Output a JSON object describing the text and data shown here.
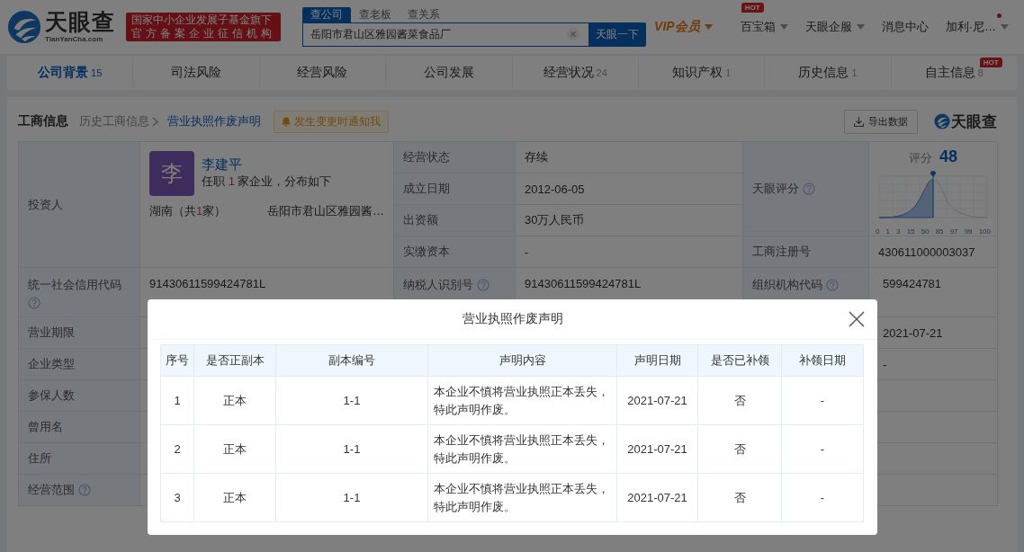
{
  "header": {
    "logo": {
      "name": "天眼查",
      "domain": "TianYanCha.com"
    },
    "slogan": [
      "国家中小企业发展子基金旗下",
      "官方备案企业征信机构"
    ],
    "search_tabs": [
      {
        "label": "查公司",
        "selected": true
      },
      {
        "label": "查老板",
        "selected": false
      },
      {
        "label": "查关系",
        "selected": false
      }
    ],
    "search": {
      "value": "岳阳市君山区雅园酱菜食品厂",
      "button": "天眼一下"
    },
    "nav": [
      {
        "kind": "vip",
        "label": "VIP会员"
      },
      {
        "kind": "menu",
        "label": "百宝箱",
        "badge": "HOT"
      },
      {
        "kind": "menu",
        "label": "天眼企服"
      },
      {
        "kind": "link",
        "label": "消息中心"
      },
      {
        "kind": "user",
        "label": "加利·尼…",
        "unread": true
      }
    ]
  },
  "tabs": [
    {
      "label": "公司背景",
      "count": "15",
      "selected": true
    },
    {
      "label": "司法风险",
      "selected": false
    },
    {
      "label": "经营风险",
      "selected": false
    },
    {
      "label": "公司发展",
      "selected": false
    },
    {
      "label": "经营状况",
      "count": "24",
      "selected": false
    },
    {
      "label": "知识产权",
      "count": "1",
      "selected": false
    },
    {
      "label": "历史信息",
      "count": "1",
      "selected": false
    },
    {
      "label": "自主信息",
      "count": "8",
      "badge": "HOT",
      "selected": false
    }
  ],
  "section": {
    "title": "工商信息",
    "parent": "历史工商信息",
    "current": "营业执照作废声明",
    "notify_button": "发生变更时通知我",
    "export_button": "导出数据",
    "brand": "天眼查"
  },
  "info": {
    "investor": {
      "label": "投资人",
      "avatar": "李",
      "name": "李建平",
      "summary_prefix": "任职",
      "count": "1",
      "summary_suffix": "家企业，分布如下",
      "region_prefix": "湖南（共",
      "region_count": "1",
      "region_suffix": "家）",
      "company": "岳阳市君山区雅园酱…"
    },
    "facts": [
      {
        "label": "经营状态",
        "value": "存续"
      },
      {
        "label": "成立日期",
        "value": "2012-06-05"
      },
      {
        "label": "出资额",
        "value": "30万人民币"
      },
      {
        "label": "实缴资本",
        "value": "-"
      }
    ],
    "score": {
      "label": "天眼评分",
      "help": true,
      "title": "评分",
      "value": "48",
      "ticks": [
        "0",
        "1",
        "3",
        "15",
        "50",
        "85",
        "97",
        "99",
        "100"
      ]
    },
    "registration": {
      "label": "工商注册号",
      "value": "430611000003037"
    },
    "rows": [
      {
        "label": "统一社会信用代码",
        "help": true,
        "value": "91430611599424781L",
        "label2": "纳税人识别号",
        "help2": true,
        "value2": "91430611599424781L",
        "label3": "组织机构代码",
        "help3": true,
        "value3": "599424781"
      },
      {
        "label": "营业期限",
        "help": false,
        "value3": "2021-07-21"
      },
      {
        "label": "企业类型",
        "help": false,
        "value3": "-"
      },
      {
        "label": "参保人数",
        "help": false
      },
      {
        "label": "曾用名",
        "help": false
      },
      {
        "label": "住所",
        "help": false
      },
      {
        "label": "经营范围",
        "help": true
      }
    ]
  },
  "modal": {
    "title": "营业执照作废声明",
    "columns": [
      "序号",
      "是否正副本",
      "副本编号",
      "声明内容",
      "声明日期",
      "是否已补领",
      "补领日期"
    ],
    "rows": [
      [
        "1",
        "正本",
        "1-1",
        "本企业不慎将营业执照正本丢失，特此声明作废。",
        "2021-07-21",
        "否",
        "-"
      ],
      [
        "2",
        "正本",
        "1-1",
        "本企业不慎将营业执照正本丢失，特此声明作废。",
        "2021-07-21",
        "否",
        "-"
      ],
      [
        "3",
        "正本",
        "1-1",
        "本企业不慎将营业执照正本丢失，特此声明作废。",
        "2021-07-21",
        "否",
        "-"
      ]
    ]
  }
}
